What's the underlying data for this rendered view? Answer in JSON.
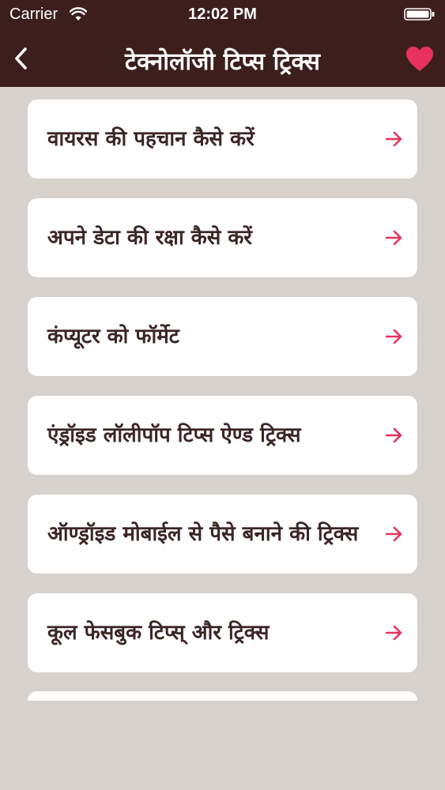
{
  "status_bar": {
    "carrier": "Carrier",
    "time": "12:02 PM"
  },
  "nav": {
    "title": "टेक्नोलॉजी टिप्स ट्रिक्स",
    "back_icon": "chevron-left-icon",
    "favorite_icon": "heart-icon",
    "accent_color": "#e8315f"
  },
  "items": [
    {
      "label": "वायरस की पहचान कैसे करें"
    },
    {
      "label": "अपने डेटा की रक्षा कैसे करें"
    },
    {
      "label": "कंप्यूटर को फॉर्मेट"
    },
    {
      "label": "एंड्रॉइड लॉलीपॉप  टिप्स ऐण्ड ट्रिक्स"
    },
    {
      "label": "ऑण्ड्रॉइड मोबाईल से  पैसे बनाने की ट्रिक्स"
    },
    {
      "label": "कूल फेसबुक टिप्स् और ट्रिक्स"
    }
  ],
  "colors": {
    "header_bg": "#3c1f1c",
    "page_bg": "#d7d2cd",
    "card_bg": "#ffffff",
    "arrow": "#e8315f"
  }
}
